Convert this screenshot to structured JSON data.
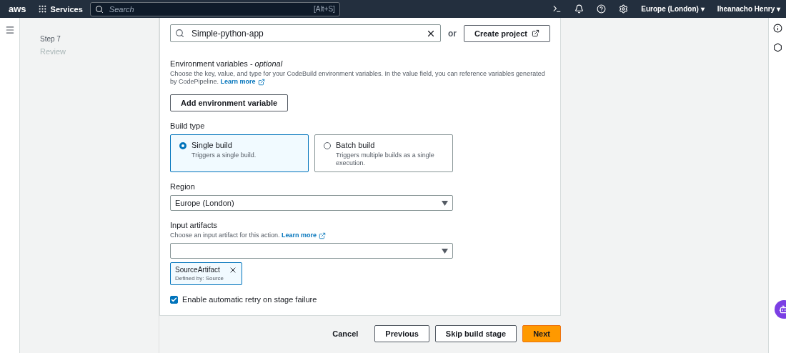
{
  "header": {
    "logo": "aws",
    "services": "Services",
    "search": {
      "placeholder": "Search",
      "shortcut": "[Alt+S]"
    },
    "region": "Europe (London)",
    "user": "Iheanacho Henry",
    "menu_caret": "▾"
  },
  "steps": [
    {
      "label": "Step 7",
      "title": "Review"
    }
  ],
  "project_search": {
    "value": "Simple-python-app"
  },
  "or": "or",
  "create_project": "Create project",
  "env": {
    "title": "Environment variables - *optional*",
    "description": "Choose the key, value, and type for your CodeBuild environment variables. In the value field, you can reference variables generated by CodePipeline.",
    "learn_more": "Learn more",
    "button": "Add environment variable"
  },
  "build_type": {
    "label": "Build type",
    "options": [
      {
        "title": "Single build",
        "description": "Triggers a single build.",
        "selected": true
      },
      {
        "title": "Batch build",
        "description": "Triggers multiple builds as a single execution.",
        "selected": false
      }
    ]
  },
  "region": {
    "label": "Region",
    "value": "Europe (London)"
  },
  "input_artifacts": {
    "label": "Input artifacts",
    "description": "Choose an input artifact for this action.",
    "learn_more": "Learn more",
    "tokens": [
      {
        "name": "SourceArtifact",
        "detail": "Defined by: Source"
      }
    ]
  },
  "retry": {
    "label": "Enable automatic retry on stage failure",
    "checked": true
  },
  "actions": [
    {
      "label": "Cancel",
      "kind": "link"
    },
    {
      "label": "Previous",
      "kind": "normal"
    },
    {
      "label": "Skip build stage",
      "kind": "normal"
    },
    {
      "label": "Next",
      "kind": "primary"
    }
  ]
}
